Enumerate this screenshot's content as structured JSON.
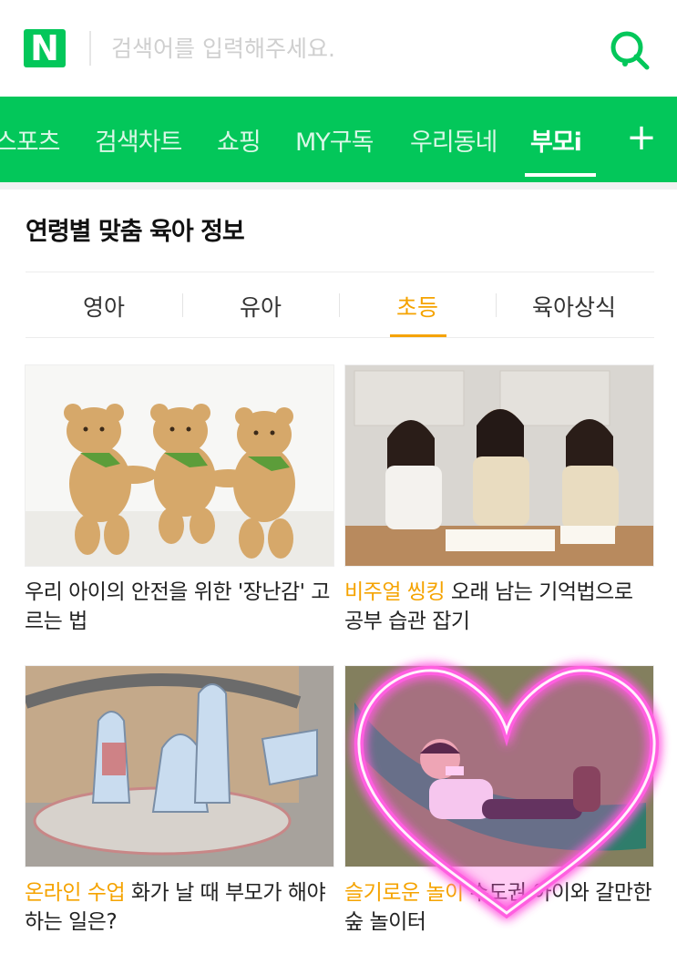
{
  "search": {
    "logo": "N",
    "placeholder": "검색어를 입력해주세요."
  },
  "tabs": [
    {
      "label": "스포츠",
      "active": false
    },
    {
      "label": "검색차트",
      "active": false
    },
    {
      "label": "쇼핑",
      "active": false
    },
    {
      "label": "MY구독",
      "active": false
    },
    {
      "label": "우리동네",
      "active": false
    },
    {
      "label": "부모i",
      "active": true
    }
  ],
  "section": {
    "title": "연령별 맞춤 육아 정보",
    "subtabs": [
      {
        "label": "영아",
        "active": false
      },
      {
        "label": "유아",
        "active": false
      },
      {
        "label": "초등",
        "active": true
      },
      {
        "label": "육아상식",
        "active": false
      }
    ]
  },
  "cards": [
    {
      "highlight": "",
      "title": "우리 아이의 안전을 위한 '장난감' 고르는 법",
      "image": "teddy-bears-image"
    },
    {
      "highlight": "비주얼 씽킹",
      "title": " 오래 남는 기억법으로 공부 습관 잡기",
      "image": "students-studying-image"
    },
    {
      "highlight": "온라인 수업",
      "title": " 화가 날 때 부모가 해야 하는 일은?",
      "image": "paper-craft-image"
    },
    {
      "highlight": "슬기로운 놀이",
      "title": " 수도권 아이와 갈만한 숲 놀이터",
      "image": "child-hammock-image"
    }
  ],
  "colors": {
    "brand": "#03c75a",
    "accent": "#f5a300",
    "heart": "#ff4fd8"
  }
}
